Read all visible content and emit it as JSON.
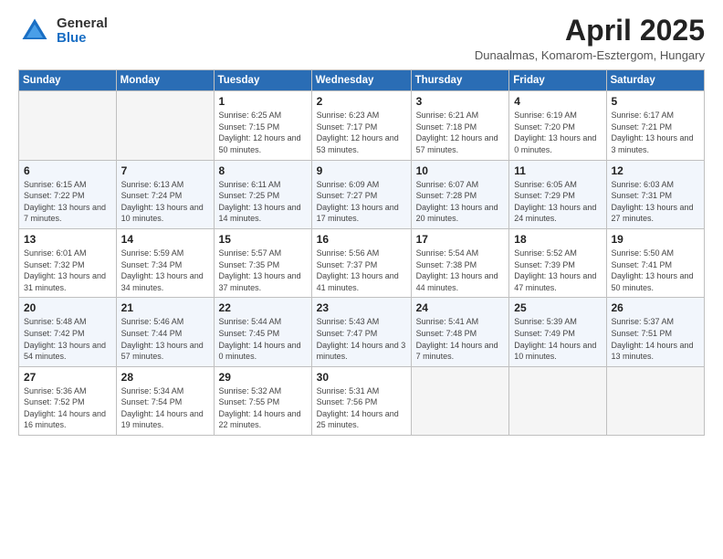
{
  "logo": {
    "general": "General",
    "blue": "Blue"
  },
  "title": "April 2025",
  "subtitle": "Dunaalmas, Komarom-Esztergom, Hungary",
  "weekdays": [
    "Sunday",
    "Monday",
    "Tuesday",
    "Wednesday",
    "Thursday",
    "Friday",
    "Saturday"
  ],
  "weeks": [
    [
      {
        "day": "",
        "empty": true
      },
      {
        "day": "",
        "empty": true
      },
      {
        "day": "1",
        "sunrise": "Sunrise: 6:25 AM",
        "sunset": "Sunset: 7:15 PM",
        "daylight": "Daylight: 12 hours and 50 minutes."
      },
      {
        "day": "2",
        "sunrise": "Sunrise: 6:23 AM",
        "sunset": "Sunset: 7:17 PM",
        "daylight": "Daylight: 12 hours and 53 minutes."
      },
      {
        "day": "3",
        "sunrise": "Sunrise: 6:21 AM",
        "sunset": "Sunset: 7:18 PM",
        "daylight": "Daylight: 12 hours and 57 minutes."
      },
      {
        "day": "4",
        "sunrise": "Sunrise: 6:19 AM",
        "sunset": "Sunset: 7:20 PM",
        "daylight": "Daylight: 13 hours and 0 minutes."
      },
      {
        "day": "5",
        "sunrise": "Sunrise: 6:17 AM",
        "sunset": "Sunset: 7:21 PM",
        "daylight": "Daylight: 13 hours and 3 minutes."
      }
    ],
    [
      {
        "day": "6",
        "sunrise": "Sunrise: 6:15 AM",
        "sunset": "Sunset: 7:22 PM",
        "daylight": "Daylight: 13 hours and 7 minutes."
      },
      {
        "day": "7",
        "sunrise": "Sunrise: 6:13 AM",
        "sunset": "Sunset: 7:24 PM",
        "daylight": "Daylight: 13 hours and 10 minutes."
      },
      {
        "day": "8",
        "sunrise": "Sunrise: 6:11 AM",
        "sunset": "Sunset: 7:25 PM",
        "daylight": "Daylight: 13 hours and 14 minutes."
      },
      {
        "day": "9",
        "sunrise": "Sunrise: 6:09 AM",
        "sunset": "Sunset: 7:27 PM",
        "daylight": "Daylight: 13 hours and 17 minutes."
      },
      {
        "day": "10",
        "sunrise": "Sunrise: 6:07 AM",
        "sunset": "Sunset: 7:28 PM",
        "daylight": "Daylight: 13 hours and 20 minutes."
      },
      {
        "day": "11",
        "sunrise": "Sunrise: 6:05 AM",
        "sunset": "Sunset: 7:29 PM",
        "daylight": "Daylight: 13 hours and 24 minutes."
      },
      {
        "day": "12",
        "sunrise": "Sunrise: 6:03 AM",
        "sunset": "Sunset: 7:31 PM",
        "daylight": "Daylight: 13 hours and 27 minutes."
      }
    ],
    [
      {
        "day": "13",
        "sunrise": "Sunrise: 6:01 AM",
        "sunset": "Sunset: 7:32 PM",
        "daylight": "Daylight: 13 hours and 31 minutes."
      },
      {
        "day": "14",
        "sunrise": "Sunrise: 5:59 AM",
        "sunset": "Sunset: 7:34 PM",
        "daylight": "Daylight: 13 hours and 34 minutes."
      },
      {
        "day": "15",
        "sunrise": "Sunrise: 5:57 AM",
        "sunset": "Sunset: 7:35 PM",
        "daylight": "Daylight: 13 hours and 37 minutes."
      },
      {
        "day": "16",
        "sunrise": "Sunrise: 5:56 AM",
        "sunset": "Sunset: 7:37 PM",
        "daylight": "Daylight: 13 hours and 41 minutes."
      },
      {
        "day": "17",
        "sunrise": "Sunrise: 5:54 AM",
        "sunset": "Sunset: 7:38 PM",
        "daylight": "Daylight: 13 hours and 44 minutes."
      },
      {
        "day": "18",
        "sunrise": "Sunrise: 5:52 AM",
        "sunset": "Sunset: 7:39 PM",
        "daylight": "Daylight: 13 hours and 47 minutes."
      },
      {
        "day": "19",
        "sunrise": "Sunrise: 5:50 AM",
        "sunset": "Sunset: 7:41 PM",
        "daylight": "Daylight: 13 hours and 50 minutes."
      }
    ],
    [
      {
        "day": "20",
        "sunrise": "Sunrise: 5:48 AM",
        "sunset": "Sunset: 7:42 PM",
        "daylight": "Daylight: 13 hours and 54 minutes."
      },
      {
        "day": "21",
        "sunrise": "Sunrise: 5:46 AM",
        "sunset": "Sunset: 7:44 PM",
        "daylight": "Daylight: 13 hours and 57 minutes."
      },
      {
        "day": "22",
        "sunrise": "Sunrise: 5:44 AM",
        "sunset": "Sunset: 7:45 PM",
        "daylight": "Daylight: 14 hours and 0 minutes."
      },
      {
        "day": "23",
        "sunrise": "Sunrise: 5:43 AM",
        "sunset": "Sunset: 7:47 PM",
        "daylight": "Daylight: 14 hours and 3 minutes."
      },
      {
        "day": "24",
        "sunrise": "Sunrise: 5:41 AM",
        "sunset": "Sunset: 7:48 PM",
        "daylight": "Daylight: 14 hours and 7 minutes."
      },
      {
        "day": "25",
        "sunrise": "Sunrise: 5:39 AM",
        "sunset": "Sunset: 7:49 PM",
        "daylight": "Daylight: 14 hours and 10 minutes."
      },
      {
        "day": "26",
        "sunrise": "Sunrise: 5:37 AM",
        "sunset": "Sunset: 7:51 PM",
        "daylight": "Daylight: 14 hours and 13 minutes."
      }
    ],
    [
      {
        "day": "27",
        "sunrise": "Sunrise: 5:36 AM",
        "sunset": "Sunset: 7:52 PM",
        "daylight": "Daylight: 14 hours and 16 minutes."
      },
      {
        "day": "28",
        "sunrise": "Sunrise: 5:34 AM",
        "sunset": "Sunset: 7:54 PM",
        "daylight": "Daylight: 14 hours and 19 minutes."
      },
      {
        "day": "29",
        "sunrise": "Sunrise: 5:32 AM",
        "sunset": "Sunset: 7:55 PM",
        "daylight": "Daylight: 14 hours and 22 minutes."
      },
      {
        "day": "30",
        "sunrise": "Sunrise: 5:31 AM",
        "sunset": "Sunset: 7:56 PM",
        "daylight": "Daylight: 14 hours and 25 minutes."
      },
      {
        "day": "",
        "empty": true
      },
      {
        "day": "",
        "empty": true
      },
      {
        "day": "",
        "empty": true
      }
    ]
  ]
}
